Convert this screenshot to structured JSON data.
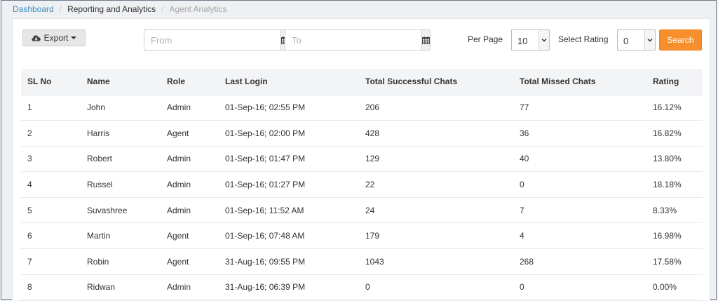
{
  "breadcrumb": {
    "home": "Dashboard",
    "section": "Reporting and Analytics",
    "current": "Agent Analytics"
  },
  "toolbar": {
    "export_label": "Export",
    "from_placeholder": "From",
    "to_placeholder": "To",
    "per_page_label": "Per Page",
    "per_page_value": "10",
    "rating_label": "Select Rating",
    "rating_value": "0",
    "search_label": "Search"
  },
  "table": {
    "columns": [
      "SL No",
      "Name",
      "Role",
      "Last Login",
      "Total Successful Chats",
      "Total Missed Chats",
      "Rating"
    ],
    "rows": [
      [
        "1",
        "John",
        "Admin",
        "01-Sep-16; 02:55 PM",
        "206",
        "77",
        "16.12%"
      ],
      [
        "2",
        "Harris",
        "Agent",
        "01-Sep-16; 02:00 PM",
        "428",
        "36",
        "16.82%"
      ],
      [
        "3",
        "Robert",
        "Admin",
        "01-Sep-16; 01:47 PM",
        "129",
        "40",
        "13.80%"
      ],
      [
        "4",
        "Russel",
        "Admin",
        "01-Sep-16; 01:27 PM",
        "22",
        "0",
        "18.18%"
      ],
      [
        "5",
        "Suvashree",
        "Admin",
        "01-Sep-16; 11:52 AM",
        "24",
        "7",
        "8.33%"
      ],
      [
        "6",
        "Martin",
        "Agent",
        "01-Sep-16; 07:48 AM",
        "179",
        "4",
        "16.98%"
      ],
      [
        "7",
        "Robin",
        "Agent",
        "31-Aug-16; 09:55 PM",
        "1043",
        "268",
        "17.58%"
      ],
      [
        "8",
        "Ridwan",
        "Admin",
        "31-Aug-16; 06:39 PM",
        "0",
        "0",
        "0.00%"
      ]
    ]
  },
  "colors": {
    "link": "#3c8dbc",
    "search_button": "#f7902c",
    "header_row": "#f3f4f6"
  },
  "icons": {
    "export": "cloud-download-icon",
    "calendar": "calendar-icon",
    "select_arrow": "chevron-down-icon"
  }
}
